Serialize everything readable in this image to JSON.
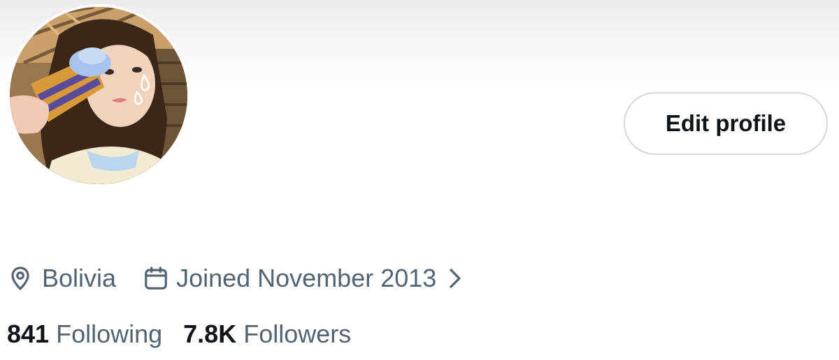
{
  "profile": {
    "avatar_alt": "Profile photo of a person holding an ice cream cone",
    "edit_button_label": "Edit profile",
    "location": "Bolivia",
    "location_icon": "location-pin-icon",
    "joined": "Joined November 2013",
    "joined_icon": "calendar-icon",
    "joined_chevron_icon": "chevron-right-icon",
    "stats": {
      "following_count": "841",
      "following_label": "Following",
      "followers_count": "7.8K",
      "followers_label": "Followers"
    }
  },
  "colors": {
    "text_primary": "#0f1419",
    "text_secondary": "#536471",
    "button_border": "#d4d9dd",
    "background": "#ffffff"
  }
}
